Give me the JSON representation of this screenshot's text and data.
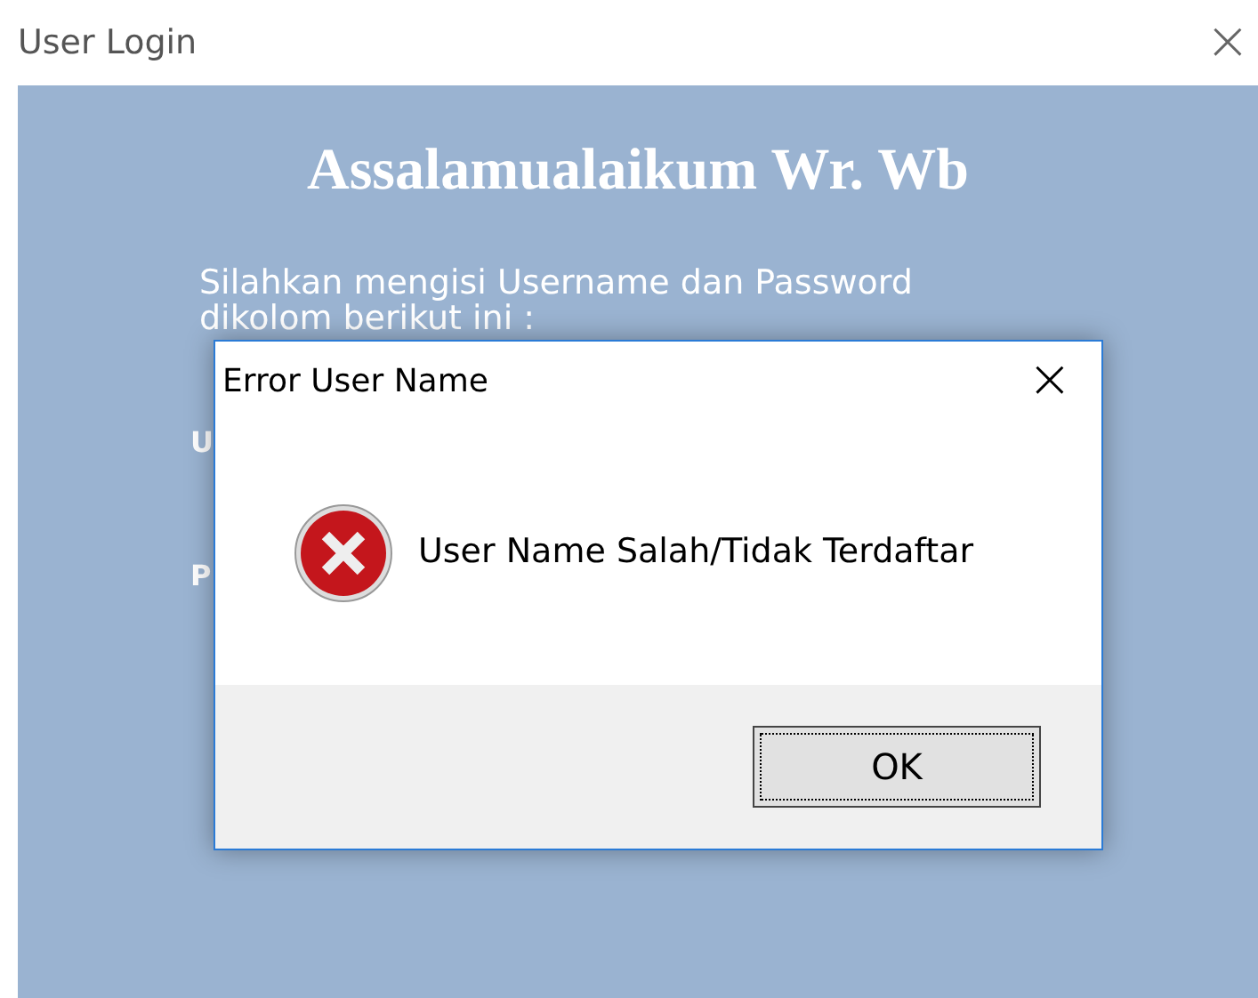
{
  "window": {
    "title": "User Login",
    "close": "×"
  },
  "form": {
    "heading": "Assalamualaikum Wr. Wb",
    "intro": [
      "Silahkan mengisi Username dan Password",
      "dikolom berikut ini :"
    ],
    "labels": [
      "U",
      "P"
    ]
  },
  "dialog": {
    "title": "Error User Name",
    "close": "×",
    "kind": "error",
    "message": "User Name Salah/Tidak Terdaftar",
    "buttons": [
      {
        "label": "OK",
        "focused": true
      }
    ]
  }
}
